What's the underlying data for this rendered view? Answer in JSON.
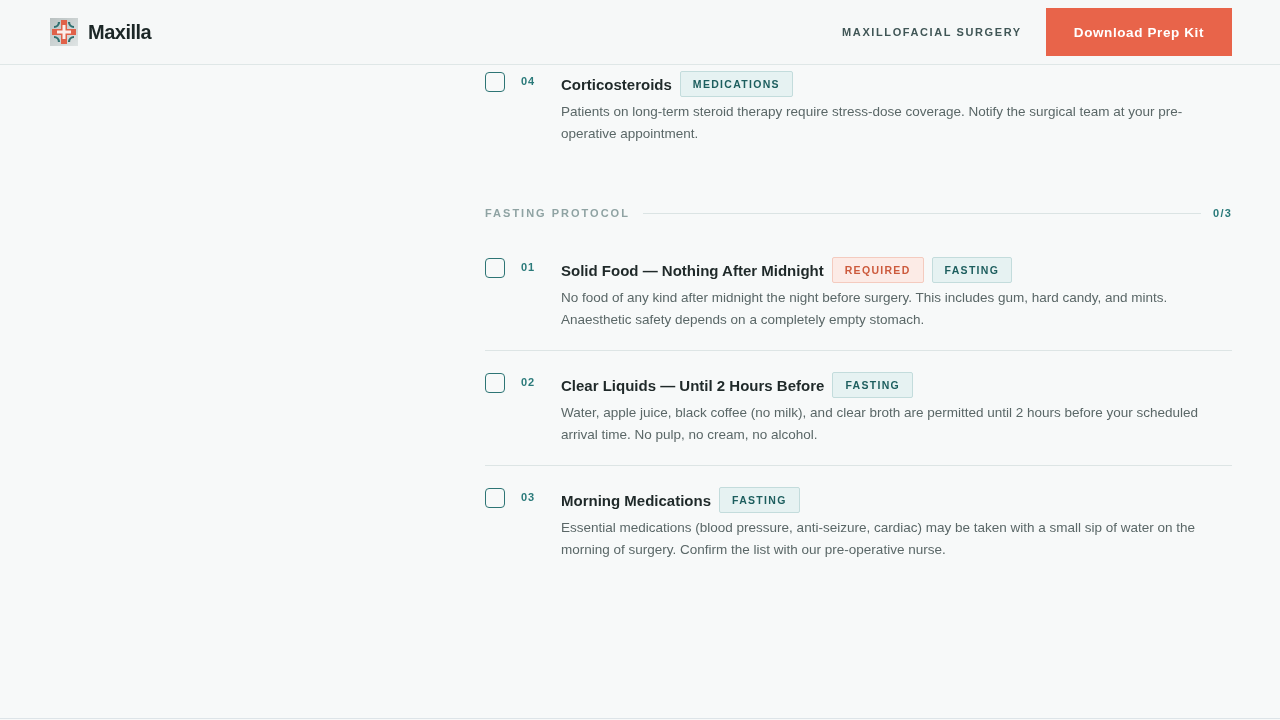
{
  "header": {
    "brand": "Maxilla",
    "specialty": "MAXILLOFACIAL SURGERY",
    "button": "Download Prep Kit"
  },
  "sections": [
    {
      "items": [
        {
          "number": "04",
          "title": "Corticosteroids",
          "checked": false,
          "tags": [
            {
              "label": "MEDICATIONS",
              "kind": "category"
            }
          ],
          "description": "Patients on long-term steroid therapy require stress-dose coverage. Notify the surgical team at your pre-operative appointment."
        }
      ]
    },
    {
      "title": "FASTING PROTOCOL",
      "count": "0/3",
      "items": [
        {
          "number": "01",
          "title": "Solid Food — Nothing After Midnight",
          "checked": false,
          "tags": [
            {
              "label": "REQUIRED",
              "kind": "required"
            },
            {
              "label": "FASTING",
              "kind": "category"
            }
          ],
          "description": "No food of any kind after midnight the night before surgery. This includes gum, hard candy, and mints. Anaesthetic safety depends on a completely empty stomach."
        },
        {
          "number": "02",
          "title": "Clear Liquids — Until 2 Hours Before",
          "checked": false,
          "tags": [
            {
              "label": "FASTING",
              "kind": "category"
            }
          ],
          "description": "Water, apple juice, black coffee (no milk), and clear broth are permitted until 2 hours before your scheduled arrival time. No pulp, no cream, no alcohol."
        },
        {
          "number": "03",
          "title": "Morning Medications",
          "checked": false,
          "tags": [
            {
              "label": "FASTING",
              "kind": "category"
            }
          ],
          "description": "Essential medications (blood pressure, anti-seizure, cardiac) may be taken with a small sip of water on the morning of surgery. Confirm the list with our pre-operative nurse."
        }
      ]
    }
  ]
}
